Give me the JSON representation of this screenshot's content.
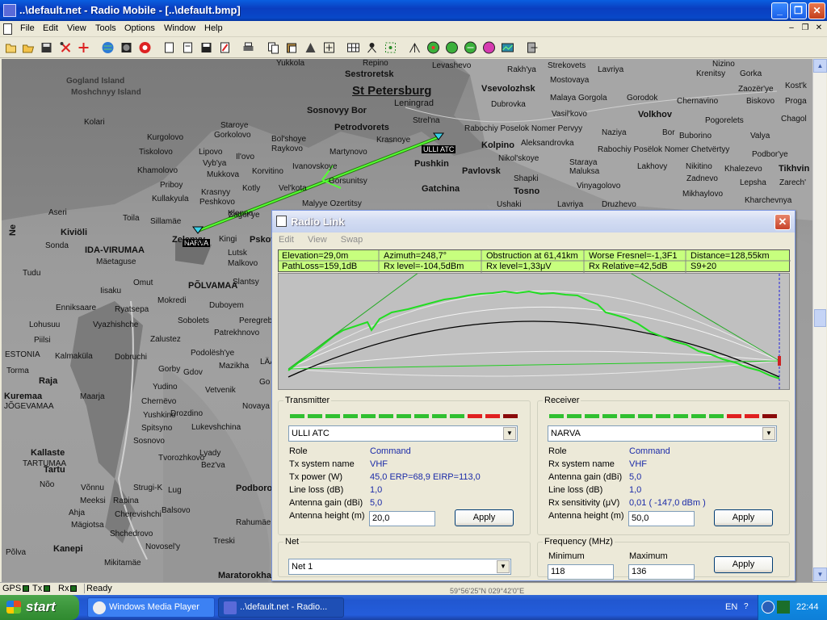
{
  "window": {
    "title": "..\\default.net - Radio Mobile - [..\\default.bmp]"
  },
  "menu": [
    "File",
    "Edit",
    "View",
    "Tools",
    "Options",
    "Window",
    "Help"
  ],
  "map": {
    "places": [
      {
        "t": "Gogland Island",
        "c": "water"
      },
      {
        "t": "Moshchnyy Island",
        "c": "water"
      },
      {
        "t": "Kolari"
      },
      {
        "t": "Kurgolovo"
      },
      {
        "t": "Tiskolovo"
      },
      {
        "t": "Khamolovo"
      },
      {
        "t": "Priboy"
      },
      {
        "t": "Kullakyula"
      },
      {
        "t": "Staroye"
      },
      {
        "t": "Gorkolovo"
      },
      {
        "t": "Lipovo"
      },
      {
        "t": "Vyb'ya"
      },
      {
        "t": "Mukkova"
      },
      {
        "t": "Krasnyy"
      },
      {
        "t": "Peshkovo"
      },
      {
        "t": "Bol'shoye"
      },
      {
        "t": "Raykovo"
      },
      {
        "t": "Il'ovo"
      },
      {
        "t": "Korvitino"
      },
      {
        "t": "Kotly"
      },
      {
        "t": "Martynovo"
      },
      {
        "t": "Ivanovskoye"
      },
      {
        "t": "Vel'kota"
      },
      {
        "t": "Gorsunitsy"
      },
      {
        "t": "Malyye Ozertitsy"
      },
      {
        "t": "Zagor'ye"
      },
      {
        "t": "Sosnovyy Bor",
        "c": "big"
      },
      {
        "t": "Petrodvorets",
        "c": "big"
      },
      {
        "t": "Sestroretsk",
        "c": "big"
      },
      {
        "t": "St Petersburg",
        "c": "xl"
      },
      {
        "t": "Leningrad"
      },
      {
        "t": "Strel'na"
      },
      {
        "t": "Krasnoye"
      },
      {
        "t": "Pushkin",
        "c": "big"
      },
      {
        "t": "Kolpino",
        "c": "big"
      },
      {
        "t": "Pavlovsk",
        "c": "big"
      },
      {
        "t": "Gatchina",
        "c": "big"
      },
      {
        "t": "Tosno",
        "c": "big"
      },
      {
        "t": "Levashevo"
      },
      {
        "t": "Vsevolozhsk",
        "c": "big"
      },
      {
        "t": "Dubrovka"
      },
      {
        "t": "Rabochiy Poselok Nomer Pervyy"
      },
      {
        "t": "Aleksandrovka"
      },
      {
        "t": "Nikol'skoye"
      },
      {
        "t": "Shapki"
      },
      {
        "t": "Ushaki"
      },
      {
        "t": "Rakh'ya"
      },
      {
        "t": "Strekovets"
      },
      {
        "t": "Mostovaya"
      },
      {
        "t": "Malaya Gorgola"
      },
      {
        "t": "Vasil'kovo"
      },
      {
        "t": "Naziya"
      },
      {
        "t": "Staraya"
      },
      {
        "t": "Maluksa"
      },
      {
        "t": "Vinyagolovo"
      },
      {
        "t": "Lavriya"
      },
      {
        "t": "Gorodok"
      },
      {
        "t": "Volkhov",
        "c": "big"
      },
      {
        "t": "Rabochiy Posëlok Nomer Chetvërtyy"
      },
      {
        "t": "Lakhovy"
      },
      {
        "t": "Nikitino"
      },
      {
        "t": "Zadnevo"
      },
      {
        "t": "Mikhaylovo"
      },
      {
        "t": "Kharchevnya"
      },
      {
        "t": "Pogorelets"
      },
      {
        "t": "Valya"
      },
      {
        "t": "Podbor'ye"
      },
      {
        "t": "Tikhvin",
        "c": "big"
      },
      {
        "t": "Khalezevo"
      },
      {
        "t": "Lepsha"
      },
      {
        "t": "Buborino"
      },
      {
        "t": "Chernavino"
      },
      {
        "t": "Krenitsy"
      },
      {
        "t": "Gorka"
      },
      {
        "t": "Nizino"
      },
      {
        "t": "Biskovo"
      },
      {
        "t": "Zaozër'ye"
      },
      {
        "t": "Kost'k"
      },
      {
        "t": "Proga"
      },
      {
        "t": "Chagol"
      },
      {
        "t": "Zarech'"
      },
      {
        "t": "Bor"
      },
      {
        "t": "Yukkola"
      },
      {
        "t": "Repino"
      },
      {
        "t": "Lavriya"
      },
      {
        "t": "Druzhevo"
      },
      {
        "t": "Aseri"
      },
      {
        "t": "Toila"
      },
      {
        "t": "Sillamäe"
      },
      {
        "t": "Kiviöli",
        "c": "big"
      },
      {
        "t": "Sonda"
      },
      {
        "t": "IDA-VIRUMAA",
        "c": "big"
      },
      {
        "t": "Mäetaguse"
      },
      {
        "t": "Tudu"
      },
      {
        "t": "Iisaku"
      },
      {
        "t": "Omut"
      },
      {
        "t": "Mokredi"
      },
      {
        "t": "Enniksaare"
      },
      {
        "t": "Ryatsepa"
      },
      {
        "t": "Lohusuu"
      },
      {
        "t": "Vyazhishche"
      },
      {
        "t": "Piilsi"
      },
      {
        "t": "Kalmaküla"
      },
      {
        "t": "Raja"
      },
      {
        "t": "ESTONIA",
        "c": "big"
      },
      {
        "t": "Torma"
      },
      {
        "t": "Kuremaa"
      },
      {
        "t": "JÕGEVAMAA",
        "c": "big"
      },
      {
        "t": "Maarja"
      },
      {
        "t": "Kallaste"
      },
      {
        "t": "Tartu",
        "c": "big"
      },
      {
        "t": "TARTUMAA",
        "c": "big"
      },
      {
        "t": "Nõo"
      },
      {
        "t": "Võnnu"
      },
      {
        "t": "Meeksi"
      },
      {
        "t": "Ahja"
      },
      {
        "t": "Mägiotsa"
      },
      {
        "t": "Põlva"
      },
      {
        "t": "Kanepi"
      },
      {
        "t": "PÕLVAMAA",
        "c": "big"
      },
      {
        "t": "Slantsy",
        "c": "big"
      },
      {
        "t": "Duboyem"
      },
      {
        "t": "Sobolets"
      },
      {
        "t": "Patrekhnovo"
      },
      {
        "t": "Peregreb"
      },
      {
        "t": "Zalustez"
      },
      {
        "t": "Dobruchi"
      },
      {
        "t": "Podolësh'ye"
      },
      {
        "t": "Gorby"
      },
      {
        "t": "Gdov"
      },
      {
        "t": "Mazikha"
      },
      {
        "t": "Yudino"
      },
      {
        "t": "Vetvenik"
      },
      {
        "t": "Chernëvo"
      },
      {
        "t": "Yushkino"
      },
      {
        "t": "Spitsyno"
      },
      {
        "t": "Sosnovo"
      },
      {
        "t": "Drozdino"
      },
      {
        "t": "Lukevshchina"
      },
      {
        "t": "Novaya Derevnya"
      },
      {
        "t": "Lyady"
      },
      {
        "t": "Bez'va"
      },
      {
        "t": "Tvorozhkovo"
      },
      {
        "t": "Podborov'ye"
      },
      {
        "t": "Strugi-K",
        "c": "big"
      },
      {
        "t": "Lug"
      },
      {
        "t": "Cherevishchi"
      },
      {
        "t": "Rapina"
      },
      {
        "t": "Balsovo"
      },
      {
        "t": "Shchedrovo"
      },
      {
        "t": "Rahumäe"
      },
      {
        "t": "Novosel'y"
      },
      {
        "t": "Mikitamäe"
      },
      {
        "t": "Treski"
      },
      {
        "t": "Maratorokha"
      },
      {
        "t": "Pskov",
        "c": "big"
      },
      {
        "t": "Kingi",
        "c": "big"
      },
      {
        "t": "Lutsk"
      },
      {
        "t": "Malkovo"
      },
      {
        "t": "Klenno"
      },
      {
        "t": "Zelenyy"
      },
      {
        "t": "Ne"
      },
      {
        "t": "LÄÄNE-VIRUMAA",
        "c": "big"
      },
      {
        "t": "Go"
      },
      {
        "t": "Le"
      }
    ],
    "sites": {
      "tx": "ULLI ATC",
      "rx": "NARVA"
    }
  },
  "status": {
    "gps": "GPS",
    "tx": "Tx",
    "rx": "Rx",
    "msg": "Ready",
    "coords": "59°56'25\"N 029°42'0\"E"
  },
  "taskbar": {
    "start": "start",
    "tasks": [
      "Windows Media Player",
      "..\\default.net - Radio..."
    ],
    "lang": "EN",
    "time": "22:44"
  },
  "radio_link": {
    "title": "Radio Link",
    "menu": [
      "Edit",
      "View",
      "Swap"
    ],
    "info": {
      "r1": [
        "Elevation=29,0m",
        "Azimuth=248,7°",
        "Obstruction at 61,41km",
        "Worse Fresnel=-1,3F1",
        "Distance=128,55km"
      ],
      "r2": [
        "PathLoss=159,1dB",
        "Rx level=-104,5dBm",
        "Rx level=1,33μV",
        "Rx Relative=42,5dB",
        "S9+20"
      ]
    },
    "transmitter": {
      "legend": "Transmitter",
      "station": "ULLI ATC",
      "rows": [
        [
          "Role",
          "Command"
        ],
        [
          "Tx system name",
          "VHF"
        ],
        [
          "Tx power (W)",
          "45,0 ERP=68,9 EIRP=113,0"
        ],
        [
          "Line loss (dB)",
          "1,0"
        ],
        [
          "Antenna gain (dBi)",
          "5,0"
        ]
      ],
      "height_label": "Antenna height (m)",
      "height": "20,0",
      "apply": "Apply"
    },
    "receiver": {
      "legend": "Receiver",
      "station": "NARVA",
      "rows": [
        [
          "Role",
          "Command"
        ],
        [
          "Rx system name",
          "VHF"
        ],
        [
          "Antenna gain (dBi)",
          "5,0"
        ],
        [
          "Line loss (dB)",
          "1,0"
        ],
        [
          "Rx sensitivity (μV)",
          "0,01  ( -147,0 dBm )"
        ]
      ],
      "height_label": "Antenna height (m)",
      "height": "50,0",
      "apply": "Apply"
    },
    "net": {
      "legend": "Net",
      "value": "Net  1"
    },
    "frequency": {
      "legend": "Frequency (MHz)",
      "min_label": "Minimum",
      "max_label": "Maximum",
      "min": "118",
      "max": "136",
      "apply": "Apply"
    },
    "meter_colors": [
      "#30c030",
      "#30c030",
      "#30c030",
      "#30c030",
      "#30c030",
      "#30c030",
      "#30c030",
      "#30c030",
      "#30c030",
      "#30c030",
      "#e02020",
      "#e02020",
      "#8a0a0a"
    ]
  }
}
